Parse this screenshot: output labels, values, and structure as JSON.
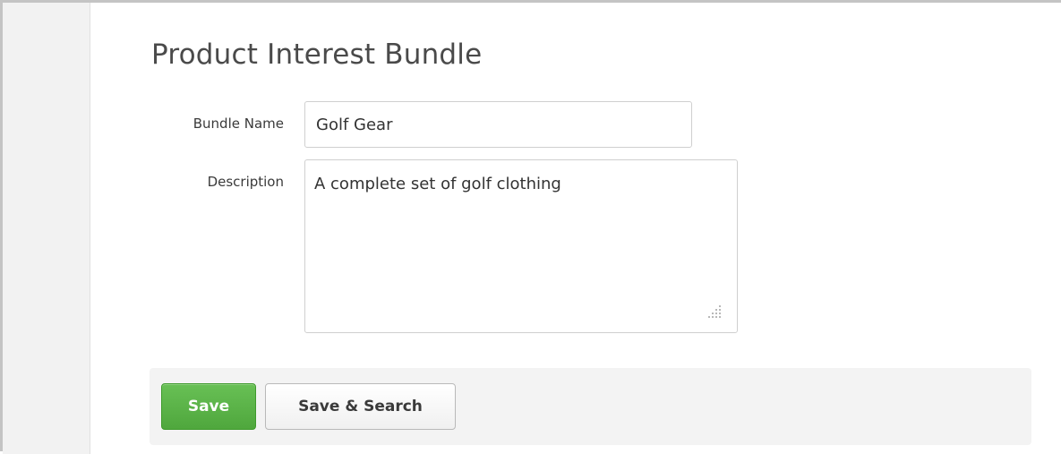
{
  "page": {
    "title": "Product Interest Bundle"
  },
  "form": {
    "bundle_name": {
      "label": "Bundle Name",
      "value": "Golf Gear"
    },
    "description": {
      "label": "Description",
      "value": "A complete set of golf clothing"
    }
  },
  "actions": {
    "save_label": "Save",
    "save_search_label": "Save & Search"
  },
  "colors": {
    "save_button": "#5cb649",
    "action_bar_bg": "#f3f3f3",
    "gutter_bg": "#f2f2f2",
    "input_border": "#cfcfcf"
  }
}
